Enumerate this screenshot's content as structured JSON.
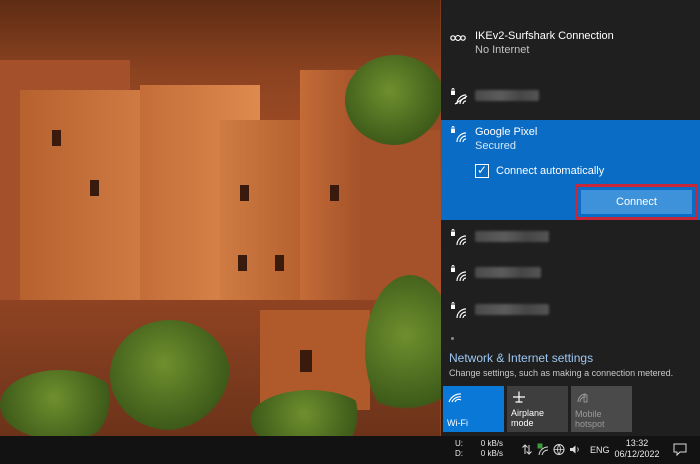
{
  "network_flyout": {
    "vpn": {
      "name": "IKEv2-Surfshark Connection",
      "status": "No Internet",
      "icon": "vpn-icon"
    },
    "networks_above": [
      {
        "name_redacted": true,
        "secured": true
      }
    ],
    "selected_network": {
      "name": "Google Pixel",
      "status": "Secured",
      "connect_automatically_label": "Connect automatically",
      "connect_automatically_checked": true,
      "connect_button_label": "Connect",
      "highlight_color": "#c6283a",
      "background_color": "#0a6cc4"
    },
    "networks_below": [
      {
        "name_redacted": true,
        "secured": true
      },
      {
        "name_redacted": true,
        "secured": true
      },
      {
        "name_redacted": true,
        "secured": true
      }
    ],
    "settings": {
      "link_label": "Network & Internet settings",
      "description": "Change settings, such as making a connection metered."
    },
    "quick_actions": [
      {
        "label": "Wi-Fi",
        "icon": "wifi-icon",
        "state": "on"
      },
      {
        "label": "Airplane mode",
        "icon": "airplane-icon",
        "state": "off"
      },
      {
        "label": "Mobile hotspot",
        "icon": "mobile-hotspot-icon",
        "state": "disabled"
      }
    ]
  },
  "taskbar": {
    "net_speed": {
      "upload_label": "U:",
      "upload_value": "0 kB/s",
      "download_label": "D:",
      "download_value": "0 kB/s"
    },
    "tray_icons": [
      "network-speed-icon",
      "wifi-status-icon",
      "globe-icon",
      "speaker-icon",
      "battery-icon"
    ],
    "language": "ENG",
    "time": "13:32",
    "date": "06/12/2022",
    "notifications_icon": "notification-icon"
  },
  "colors": {
    "accent": "#0a78d7",
    "flyout_bg": "#1f1f1f",
    "link": "#9cc7f3"
  }
}
